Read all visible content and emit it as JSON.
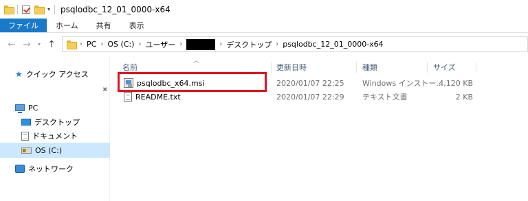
{
  "window": {
    "title": "psqlodbc_12_01_0000-x64"
  },
  "ribbon": {
    "tabs": [
      "ファイル",
      "ホーム",
      "共有",
      "表示"
    ]
  },
  "address": {
    "crumbs": [
      "PC",
      "OS (C:)",
      "ユーザー",
      "デスクトップ",
      "psqlodbc_12_01_0000-x64"
    ]
  },
  "sidebar": {
    "quick_access": "クイック アクセス",
    "pc": "PC",
    "desktop": "デスクトップ",
    "documents": "ドキュメント",
    "drive": "OS (C:)",
    "network": "ネットワーク"
  },
  "columns": {
    "name": "名前",
    "date": "更新日時",
    "type": "種類",
    "size": "サイズ"
  },
  "files": [
    {
      "name": "psqlodbc_x64.msi",
      "date": "2020/01/07 22:25",
      "type": "Windows インストー...",
      "size": "4,120 KB",
      "icon": "msi-installer-icon"
    },
    {
      "name": "README.txt",
      "date": "2020/01/07 22:29",
      "type": "テキスト文書",
      "size": "2 KB",
      "icon": "text-document-icon"
    }
  ],
  "colors": {
    "file_tab": "#1979ca",
    "selection": "#cce8ff",
    "highlight_box": "#e3121f"
  }
}
